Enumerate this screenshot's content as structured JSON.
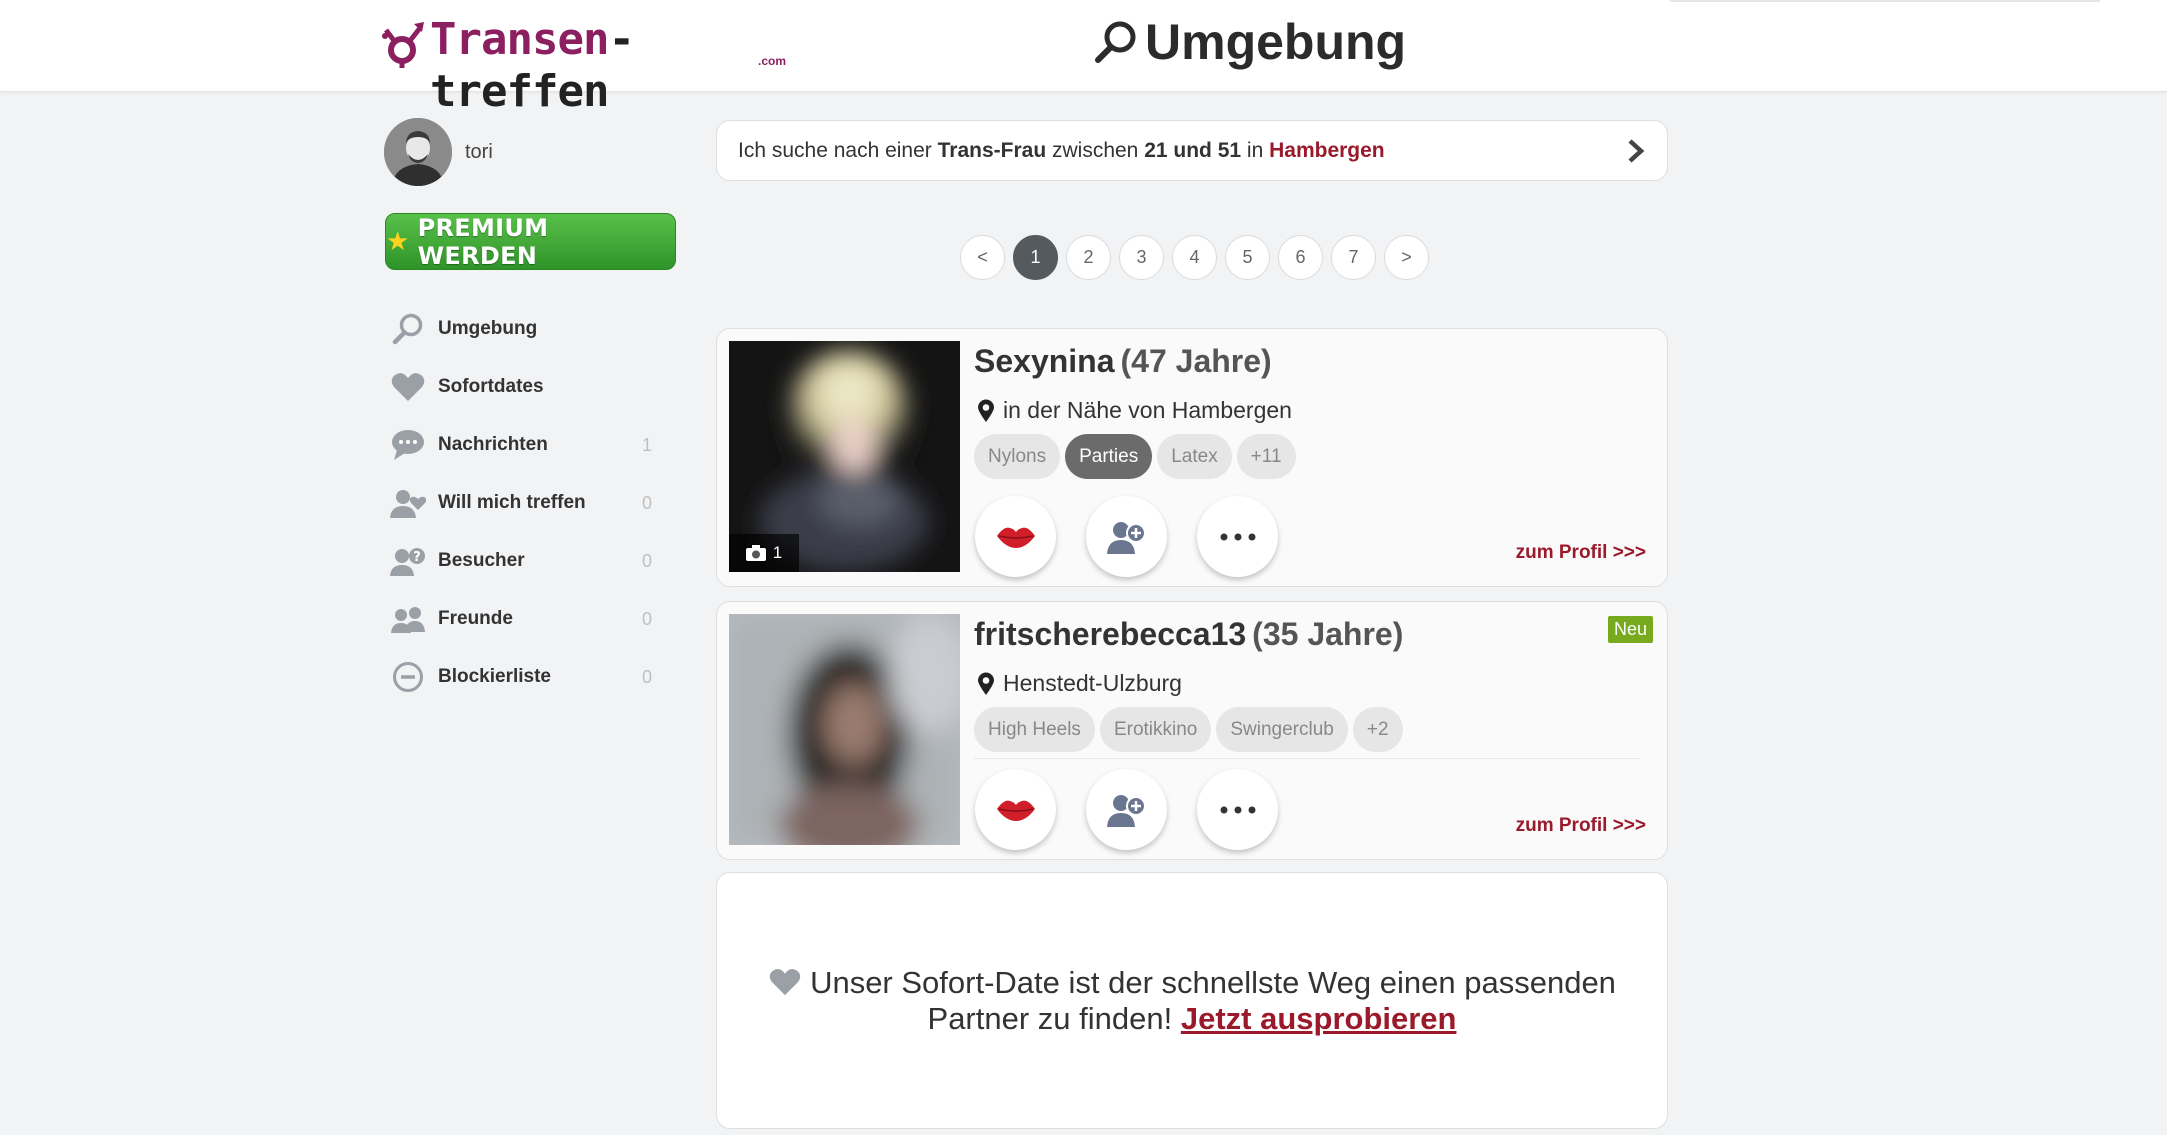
{
  "header": {
    "logo_part1": "Transen",
    "logo_part2": "-treffen",
    "logo_suffix": ".com",
    "page_title": "Umgebung"
  },
  "user": {
    "name": "tori"
  },
  "sidebar": {
    "premium_label": "PREMIUM WERDEN",
    "items": [
      {
        "label": "Umgebung",
        "count": "",
        "icon": "search-icon"
      },
      {
        "label": "Sofortdates",
        "count": "",
        "icon": "heart-icon"
      },
      {
        "label": "Nachrichten",
        "count": "1",
        "icon": "chat-icon"
      },
      {
        "label": "Will mich treffen",
        "count": "0",
        "icon": "user-heart-icon"
      },
      {
        "label": "Besucher",
        "count": "0",
        "icon": "user-question-icon"
      },
      {
        "label": "Freunde",
        "count": "0",
        "icon": "users-icon"
      },
      {
        "label": "Blockierliste",
        "count": "0",
        "icon": "block-icon"
      }
    ]
  },
  "search": {
    "prefix": "Ich suche nach einer ",
    "type": "Trans-Frau",
    "between": " zwischen ",
    "range": "21 und 51",
    "in": " in ",
    "city": "Hambergen"
  },
  "pagination": {
    "prev": "<",
    "pages": [
      "1",
      "2",
      "3",
      "4",
      "5",
      "6",
      "7"
    ],
    "next": ">",
    "active": "1"
  },
  "profiles": [
    {
      "name": "Sexynina",
      "age": "(47 Jahre)",
      "location": "in der Nähe von Hambergen",
      "photo_count": "1",
      "tags": [
        "Nylons",
        "Parties",
        "Latex",
        "+11"
      ],
      "active_tag": "Parties",
      "badge": "",
      "link": "zum Profil >>>"
    },
    {
      "name": "fritscherebecca13",
      "age": "(35 Jahre)",
      "location": "Henstedt-Ulzburg",
      "photo_count": "",
      "tags": [
        "High Heels",
        "Erotikkino",
        "Swingerclub",
        "+2"
      ],
      "active_tag": "",
      "badge": "Neu",
      "link": "zum Profil >>>"
    }
  ],
  "promo": {
    "text": "Unser Sofort-Date ist der schnellste Weg einen passenden Partner zu finden!",
    "link": "Jetzt ausprobieren"
  },
  "colors": {
    "brand": "#8c1f5f",
    "accent_red": "#9a1a2c",
    "premium_green": "#3fa632",
    "new_badge": "#77aa1e"
  }
}
